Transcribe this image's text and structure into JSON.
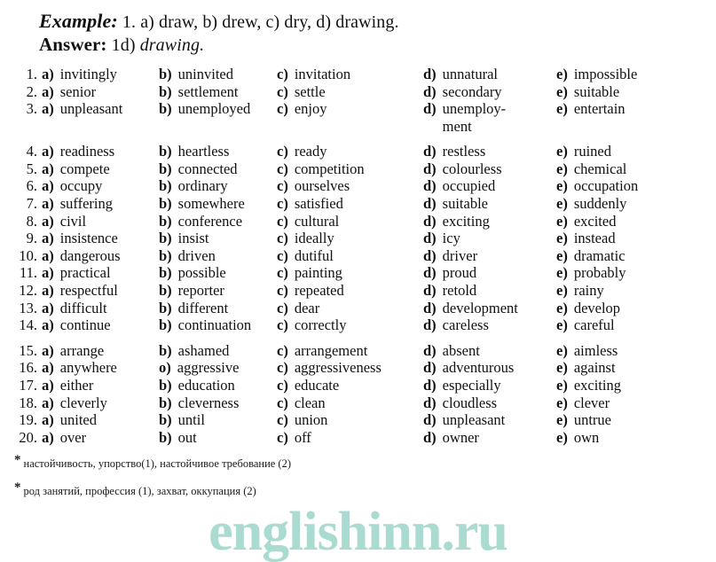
{
  "example": {
    "example_label": "Example:",
    "example_text_plain": " 1. a) draw, b) drew, c) dry, d) drawing.",
    "answer_label": "Answer:",
    "answer_prefix": " 1d) ",
    "answer_word": "drawing."
  },
  "watermark": {
    "text": "englishinn.ru",
    "color": "#a9dbd0"
  },
  "option_keys": {
    "a": "a)",
    "b": "b)",
    "c": "c)",
    "d": "d)",
    "e": "e)",
    "b_damaged": "o)"
  },
  "groups": [
    {
      "rows": [
        {
          "num": "1.",
          "a": "invitingly",
          "b": "uninvited",
          "c": "invitation",
          "d": "unnatural",
          "e": "impossible"
        },
        {
          "num": "2.",
          "a": "senior",
          "b": "settlement",
          "c": "settle",
          "d": "secondary",
          "e": "suitable"
        },
        {
          "num": "3.",
          "a": "unpleasant",
          "b": "unemployed",
          "c": "enjoy",
          "d": "unemploy-\nment",
          "e": "entertain",
          "tall": true
        }
      ]
    },
    {
      "rows": [
        {
          "num": "4.",
          "a": "readiness",
          "b": "heartless",
          "c": "ready",
          "d": "restless",
          "e": "ruined"
        },
        {
          "num": "5.",
          "a": "compete",
          "b": "connected",
          "c": "competition",
          "d": "colourless",
          "e": "chemical"
        },
        {
          "num": "6.",
          "a": "occupy",
          "b": "ordinary",
          "c": "ourselves",
          "d": "occupied",
          "e": "occupation"
        },
        {
          "num": "7.",
          "a": "suffering",
          "b": "somewhere",
          "c": "satisfied",
          "d": "suitable",
          "e": "suddenly"
        },
        {
          "num": "8.",
          "a": "civil",
          "b": "conference",
          "c": "cultural",
          "d": "exciting",
          "e": "excited"
        },
        {
          "num": "9.",
          "a": "insistence",
          "b": "insist",
          "c": "ideally",
          "d": "icy",
          "e": "instead"
        },
        {
          "num": "10.",
          "a": "dangerous",
          "b": "driven",
          "c": "dutiful",
          "d": "driver",
          "e": "dramatic"
        },
        {
          "num": "11.",
          "a": "practical",
          "b": "possible",
          "c": "painting",
          "d": "proud",
          "e": "probably"
        },
        {
          "num": "12.",
          "a": "respectful",
          "b": "reporter",
          "c": "repeated",
          "d": "retold",
          "e": "rainy"
        },
        {
          "num": "13.",
          "a": "difficult",
          "b": "different",
          "c": "dear",
          "d": "development",
          "e": "develop"
        },
        {
          "num": "14.",
          "a": "continue",
          "b": "continuation",
          "c": "correctly",
          "d": "careless",
          "e": "careful"
        }
      ]
    },
    {
      "rows": [
        {
          "num": "15.",
          "a": "arrange",
          "b": "ashamed",
          "c": "arrangement",
          "d": "absent",
          "e": "aimless"
        },
        {
          "num": "16.",
          "a": "anywhere",
          "b": "aggressive",
          "c": "aggressiveness",
          "d": "adventurous",
          "e": "against",
          "b_damaged": true
        },
        {
          "num": "17.",
          "a": "either",
          "b": "education",
          "c": "educate",
          "d": "especially",
          "e": "exciting"
        },
        {
          "num": "18.",
          "a": "cleverly",
          "b": "cleverness",
          "c": "clean",
          "d": "cloudless",
          "e": "clever"
        },
        {
          "num": "19.",
          "a": "united",
          "b": "until",
          "c": "union",
          "d": "unpleasant",
          "e": "untrue"
        },
        {
          "num": "20.",
          "a": "over",
          "b": "out",
          "c": "off",
          "d": "owner",
          "e": "own"
        }
      ]
    }
  ],
  "footnotes": [
    {
      "star": "*",
      "text": "настойчивость, упорство(1), настойчивое требование (2)"
    },
    {
      "star": "*",
      "text": "род занятий, профессия (1), захват, оккупация (2)"
    }
  ]
}
